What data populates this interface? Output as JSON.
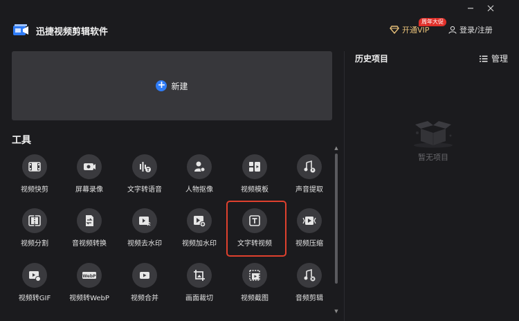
{
  "app": {
    "title": "迅捷视频剪辑软件",
    "vip_label": "开通VIP",
    "vip_promo_tag": "周年大促",
    "login_label": "登录/注册",
    "window_buttons": [
      "minimize",
      "close"
    ]
  },
  "main": {
    "new_label": "新建",
    "tools_title": "工具",
    "tools": [
      {
        "label": "视频快剪",
        "icon": "film-icon"
      },
      {
        "label": "屏幕录像",
        "icon": "screen-record-icon"
      },
      {
        "label": "文字转语音",
        "icon": "text-to-speech-icon"
      },
      {
        "label": "人物抠像",
        "icon": "person-cutout-icon"
      },
      {
        "label": "视频模板",
        "icon": "video-template-icon"
      },
      {
        "label": "声音提取",
        "icon": "audio-extract-icon"
      },
      {
        "label": "视频分割",
        "icon": "video-split-icon"
      },
      {
        "label": "音视频转换",
        "icon": "av-convert-icon"
      },
      {
        "label": "视频去水印",
        "icon": "remove-watermark-icon"
      },
      {
        "label": "视频加水印",
        "icon": "add-watermark-icon"
      },
      {
        "label": "文字转视频",
        "icon": "text-to-video-icon"
      },
      {
        "label": "视频压缩",
        "icon": "video-compress-icon"
      },
      {
        "label": "视频转GIF",
        "icon": "video-to-gif-icon"
      },
      {
        "label": "视频转WebP",
        "icon": "video-to-webp-icon"
      },
      {
        "label": "视频合并",
        "icon": "video-merge-icon"
      },
      {
        "label": "画面裁切",
        "icon": "crop-icon"
      },
      {
        "label": "视频截图",
        "icon": "video-screenshot-icon"
      },
      {
        "label": "音频剪辑",
        "icon": "audio-edit-icon"
      }
    ],
    "highlighted_tool": "文字转视频"
  },
  "history": {
    "title": "历史项目",
    "manage_label": "管理",
    "empty_text": "暂无项目"
  },
  "colors": {
    "background": "#1b1b1e",
    "card": "#37373b",
    "accent_blue": "#2f7cf6",
    "highlight_red": "#e0412e",
    "vip_gold": "#e9c27a"
  }
}
